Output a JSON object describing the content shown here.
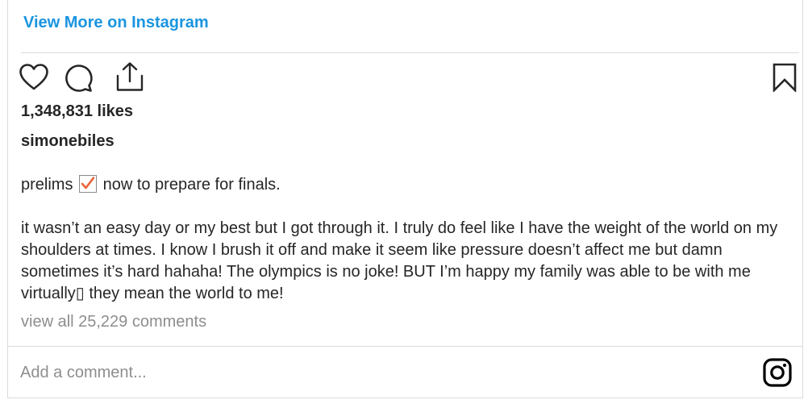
{
  "header": {
    "view_more_label": "View More on Instagram"
  },
  "post": {
    "likes": "1,348,831 likes",
    "username": "simonebiles",
    "caption_line1_before": "prelims",
    "caption_line1_after": "now to prepare for finals.",
    "caption_line1_emoji": "check-mark-box-icon",
    "caption_body": "it wasn’t an easy day or my best but I got through it. I truly do feel like I have the weight of the world on my shoulders at times. I know I brush it off and make it seem like pressure doesn’t affect me but damn sometimes it’s hard hahaha! The olympics is no joke! BUT I’m happy my family was able to be with me virtually▯ they mean the world to me!",
    "view_all_comments": "view all 25,229 comments"
  },
  "comment": {
    "placeholder": "Add a comment..."
  },
  "icons": {
    "like": "heart-icon",
    "comment": "comment-bubble-icon",
    "share": "share-icon",
    "save": "bookmark-icon",
    "brand": "instagram-icon"
  },
  "colors": {
    "link_blue": "#1a95e0",
    "text": "#262626",
    "muted": "#8e8e8e",
    "divider": "#dbdbdb",
    "check_orange": "#e8643a"
  }
}
